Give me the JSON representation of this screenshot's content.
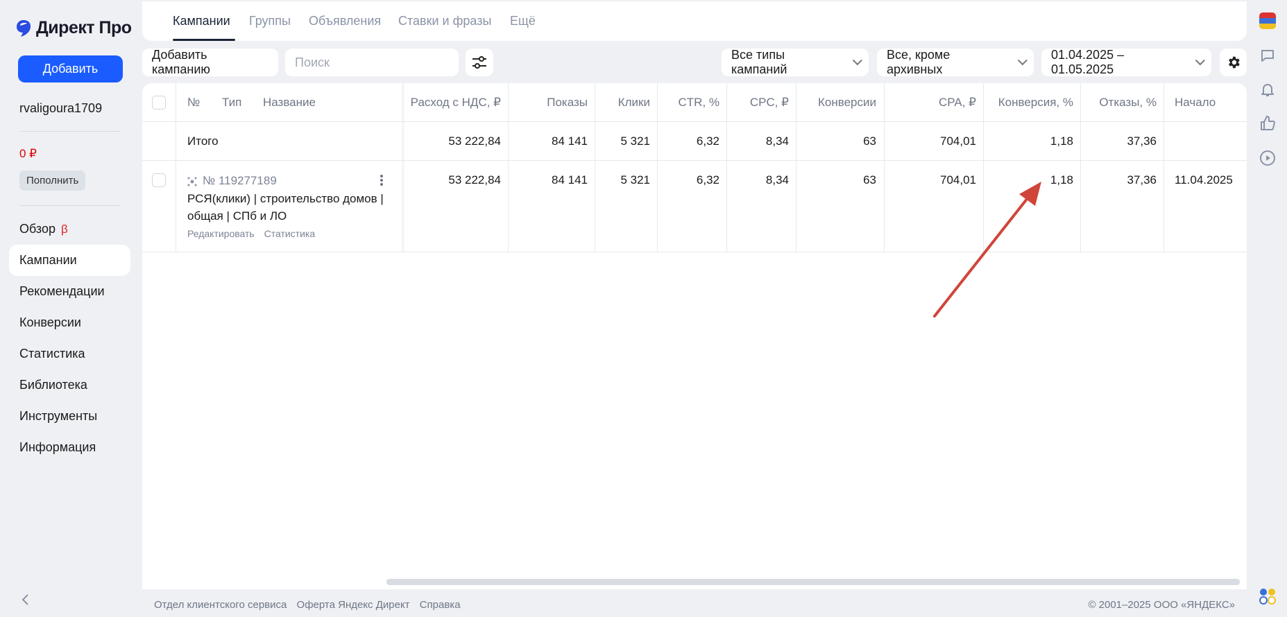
{
  "app": {
    "logo_text": "Директ Про"
  },
  "sidebar": {
    "add_label": "Добавить",
    "username": "rvaligoura1709",
    "balance": "0 ₽",
    "topup_label": "Пополнить",
    "beta_mark": "β",
    "items": [
      {
        "label": "Обзор"
      },
      {
        "label": "Кампании"
      },
      {
        "label": "Рекомендации"
      },
      {
        "label": "Конверсии"
      },
      {
        "label": "Статистика"
      },
      {
        "label": "Библиотека"
      },
      {
        "label": "Инструменты"
      },
      {
        "label": "Информация"
      }
    ]
  },
  "tabs": [
    {
      "label": "Кампании"
    },
    {
      "label": "Группы"
    },
    {
      "label": "Объявления"
    },
    {
      "label": "Ставки и фразы"
    },
    {
      "label": "Ещё"
    }
  ],
  "toolbar": {
    "add_campaign": "Добавить кампанию",
    "search_placeholder": "Поиск",
    "campaign_type": "Все типы кампаний",
    "archive_filter": "Все, кроме архивных",
    "date_range": "01.04.2025 – 01.05.2025"
  },
  "table": {
    "headers": {
      "num": "№",
      "type": "Тип",
      "name": "Название",
      "spend": "Расход с НДС, ₽",
      "impressions": "Показы",
      "clicks": "Клики",
      "ctr": "CTR, %",
      "cpc": "CPC, ₽",
      "conversions": "Конверсии",
      "cpa": "CPA, ₽",
      "conv_rate": "Конверсия, %",
      "bounces": "Отказы, %",
      "start": "Начало"
    },
    "total": {
      "label": "Итого",
      "spend": "53 222,84",
      "impressions": "84 141",
      "clicks": "5 321",
      "ctr": "6,32",
      "cpc": "8,34",
      "conversions": "63",
      "cpa": "704,01",
      "conv_rate": "1,18",
      "bounces": "37,36"
    },
    "rows": [
      {
        "id": "№ 119277189",
        "name": "РСЯ(клики) | строительство домов | общая | СПб и ЛО",
        "edit_link": "Редактировать",
        "stats_link": "Статистика",
        "spend": "53 222,84",
        "impressions": "84 141",
        "clicks": "5 321",
        "ctr": "6,32",
        "cpc": "8,34",
        "conversions": "63",
        "cpa": "704,01",
        "conv_rate": "1,18",
        "bounces": "37,36",
        "start": "11.04.2025"
      }
    ]
  },
  "footer": {
    "link1": "Отдел клиентского сервиса",
    "link2": "Оферта Яндекс Директ",
    "link3": "Справка",
    "copyright": "© 2001–2025 ООО «ЯНДЕКС»"
  },
  "colors": {
    "accent": "#1a5cff",
    "annotation_arrow": "#d0453a",
    "balance": "#e00000"
  }
}
